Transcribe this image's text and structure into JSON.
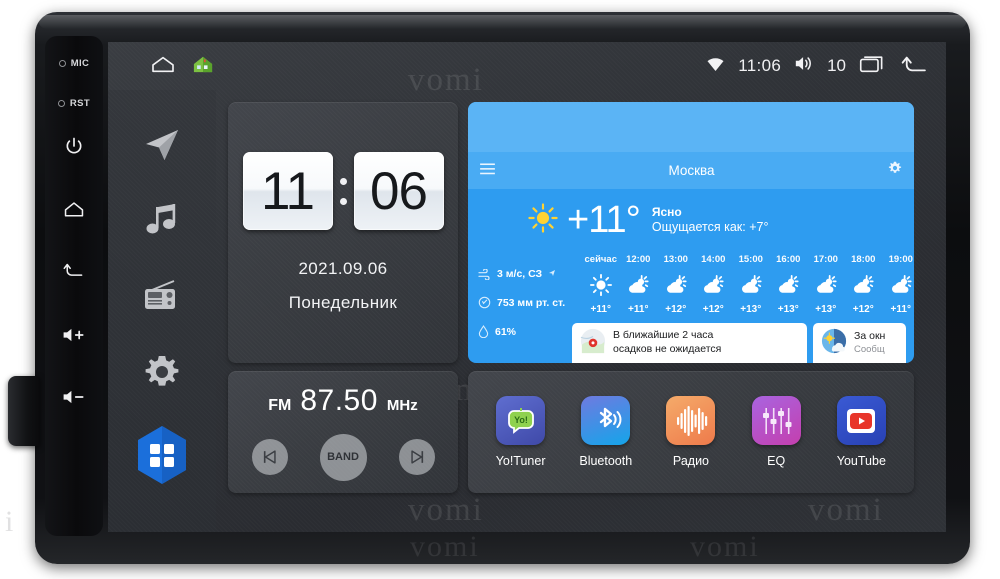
{
  "device": {
    "hardware_buttons": [
      {
        "name": "mic",
        "label": "MIC",
        "type": "dot"
      },
      {
        "name": "reset",
        "label": "RST",
        "type": "dot"
      },
      {
        "name": "power",
        "label": "power-icon",
        "type": "icon"
      },
      {
        "name": "home",
        "label": "home-icon",
        "type": "icon"
      },
      {
        "name": "back",
        "label": "back-icon",
        "type": "icon"
      },
      {
        "name": "volume-up",
        "label": "volume-up-icon",
        "type": "icon"
      },
      {
        "name": "volume-down",
        "label": "volume-down-icon",
        "type": "icon"
      }
    ],
    "watermark": "vomi"
  },
  "statusbar": {
    "left_icons": [
      "home-outline-icon",
      "house-color-icon"
    ],
    "wifi_icon": "wifi-icon",
    "time": "11:06",
    "volume_icon": "volume-icon",
    "volume_level": "10",
    "recents_icon": "recents-icon",
    "back_icon": "back-arrow-icon"
  },
  "rail": {
    "items": [
      {
        "name": "navigation",
        "icon": "navigation-arrow-icon"
      },
      {
        "name": "music",
        "icon": "music-note-icon"
      },
      {
        "name": "radio",
        "icon": "radio-icon"
      },
      {
        "name": "settings",
        "icon": "gear-icon"
      },
      {
        "name": "all-apps",
        "icon": "apps-grid-icon",
        "active": true,
        "color": "#1b6fdb"
      }
    ]
  },
  "clock": {
    "hours": "11",
    "minutes": "06",
    "date": "2021.09.06",
    "weekday": "Понедельник"
  },
  "radio": {
    "band_label": "FM",
    "frequency": "87.50",
    "unit": "MHz",
    "prev_label": "prev-icon",
    "band_button": "BAND",
    "next_label": "next-icon"
  },
  "weather": {
    "menu_icon": "hamburger-menu-icon",
    "city": "Москва",
    "condition_icon": "sun-icon",
    "temperature": "+11°",
    "condition": "Ясно",
    "feels_like": "Ощущается как: +7°",
    "metrics": [
      {
        "icon": "wind-icon",
        "value": "3 м/с, СЗ"
      },
      {
        "icon": "pressure-icon",
        "value": "753 мм рт. ст."
      },
      {
        "icon": "humidity-icon",
        "value": "61%"
      }
    ],
    "settings_icon": "gear-icon",
    "hours": [
      {
        "time": "сейчас",
        "icon": "sun",
        "temp": "+11°"
      },
      {
        "time": "12:00",
        "icon": "sun-cloud",
        "temp": "+11°"
      },
      {
        "time": "13:00",
        "icon": "sun-cloud",
        "temp": "+12°"
      },
      {
        "time": "14:00",
        "icon": "sun-cloud",
        "temp": "+12°"
      },
      {
        "time": "15:00",
        "icon": "sun-cloud",
        "temp": "+13°"
      },
      {
        "time": "16:00",
        "icon": "sun-cloud",
        "temp": "+13°"
      },
      {
        "time": "17:00",
        "icon": "sun-cloud",
        "temp": "+13°"
      },
      {
        "time": "18:00",
        "icon": "sun-cloud",
        "temp": "+12°"
      },
      {
        "time": "19:00",
        "icon": "sun-cloud",
        "temp": "+11°"
      }
    ],
    "cards": [
      {
        "name": "precipitation-card",
        "icon": "map-pin-icon",
        "line1": "В ближайшие 2 часа",
        "line2": "осадков не ожидается"
      },
      {
        "name": "outside-card",
        "icon": "day-night-icon",
        "line1": "За окн",
        "line2": "Сообщ"
      }
    ]
  },
  "apps": [
    {
      "name": "yotuner",
      "label": "Yo!Tuner",
      "icon": "yo-tuner-icon",
      "color": "#4a56bd"
    },
    {
      "name": "bluetooth",
      "label": "Bluetooth",
      "icon": "bluetooth-icon",
      "color": "#1aa3e8"
    },
    {
      "name": "radio",
      "label": "Радио",
      "icon": "waveform-icon",
      "color": "#f0954e"
    },
    {
      "name": "eq",
      "label": "EQ",
      "icon": "equalizer-icon",
      "color": "#b247d0"
    },
    {
      "name": "youtube",
      "label": "YouTube",
      "icon": "youtube-icon",
      "color": "#2f4fc4"
    }
  ]
}
